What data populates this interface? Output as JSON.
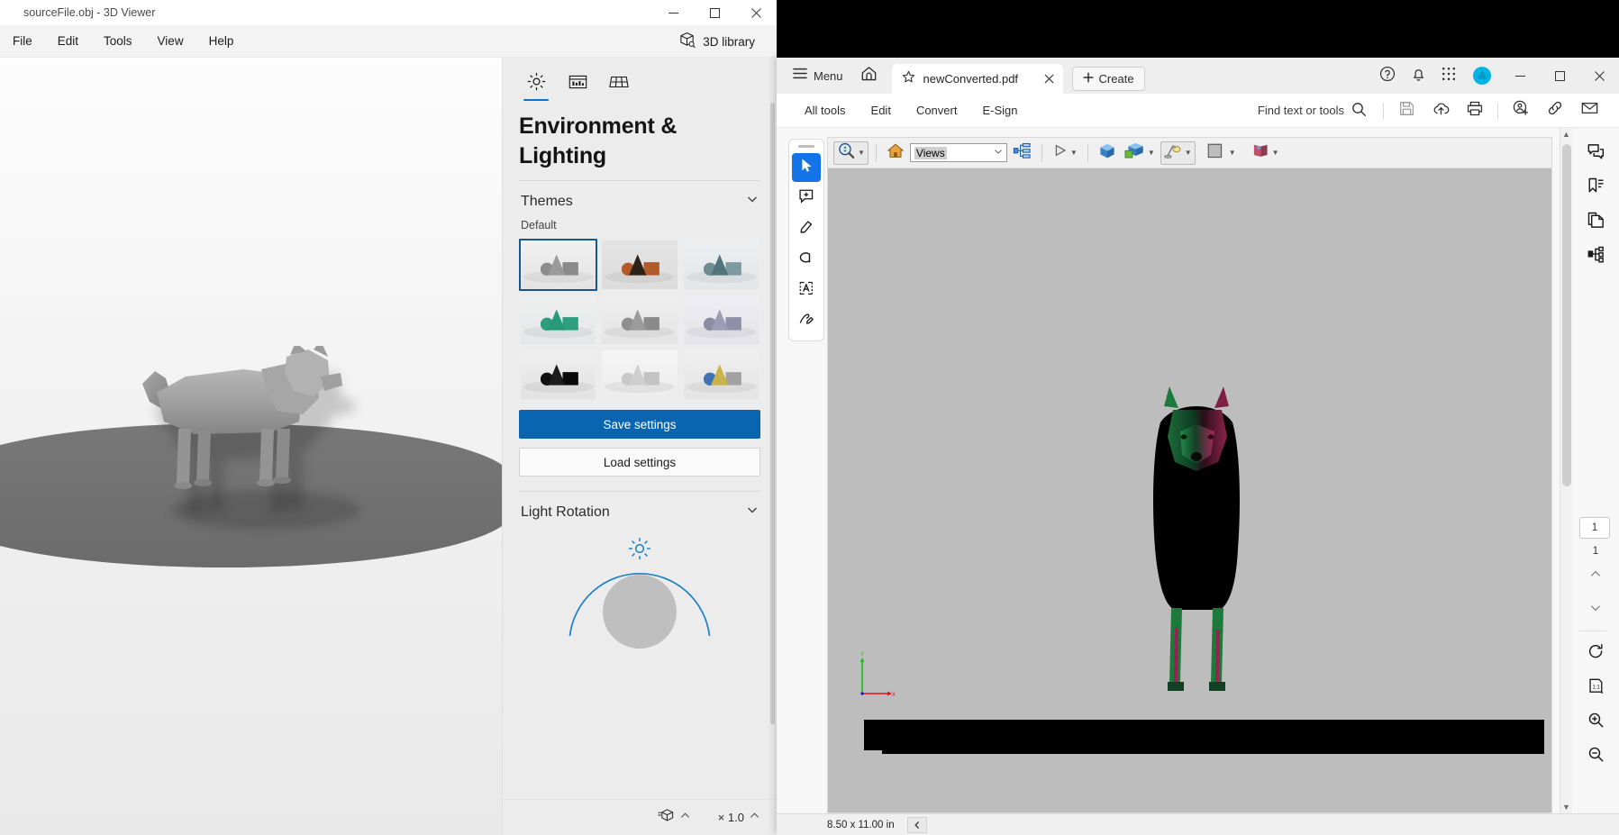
{
  "viewer": {
    "title": "sourceFile.obj - 3D Viewer",
    "window_controls": {
      "minimize": "minimize-icon",
      "maximize": "maximize-icon",
      "close": "close-icon"
    },
    "menu": [
      "File",
      "Edit",
      "Tools",
      "View",
      "Help"
    ],
    "library_button": "3D library",
    "panel": {
      "tabs": [
        {
          "name": "environment-lighting",
          "icon": "sun-icon",
          "active": true
        },
        {
          "name": "model-view",
          "icon": "filmstrip-icon",
          "active": false
        },
        {
          "name": "grid-stage",
          "icon": "grid-icon",
          "active": false
        }
      ],
      "heading": "Environment & Lighting",
      "themes_section": {
        "title": "Themes",
        "collapse_icon": "chevron-down-icon",
        "group_label": "Default",
        "items": [
          {
            "name": "theme-default-grey",
            "selected": true,
            "bg_top": "#f0f0f0",
            "bg_bottom": "#e3e3e3",
            "shape": "#8c8c8c",
            "cone": "#9a9a9a",
            "cube": "#8a8a8a"
          },
          {
            "name": "theme-sunset-orange",
            "selected": false,
            "bg_top": "#e4e4e4",
            "bg_bottom": "#dcdcdc",
            "shape": "#b35a2a",
            "cone": "#2c2218",
            "cube": "#b35a2a"
          },
          {
            "name": "theme-teal-light",
            "selected": false,
            "bg_top": "#eceff1",
            "bg_bottom": "#e3e6e8",
            "shape": "#6e8c91",
            "cone": "#52757c",
            "cube": "#7d9aa0"
          },
          {
            "name": "theme-emerald",
            "selected": false,
            "bg_top": "#eef0f0",
            "bg_bottom": "#e4e7e7",
            "shape": "#2e9e7e",
            "cone": "#26997a",
            "cube": "#2e9e7e"
          },
          {
            "name": "theme-neutral-grey",
            "selected": false,
            "bg_top": "#eeeeee",
            "bg_bottom": "#e4e4e4",
            "shape": "#8f8f8f",
            "cone": "#9b9b9b",
            "cube": "#8a8a8a"
          },
          {
            "name": "theme-lavender",
            "selected": false,
            "bg_top": "#ededf2",
            "bg_bottom": "#e4e4ea",
            "shape": "#8c8ca3",
            "cone": "#9c9cb5",
            "cube": "#8f8fa8"
          },
          {
            "name": "theme-dark-black",
            "selected": false,
            "bg_top": "#efefef",
            "bg_bottom": "#e2e2e2",
            "shape": "#111111",
            "cone": "#1c1c1c",
            "cube": "#0a0a0a"
          },
          {
            "name": "theme-bright-white",
            "selected": false,
            "bg_top": "#f5f5f5",
            "bg_bottom": "#ececec",
            "shape": "#c9c9c9",
            "cone": "#cfcfcf",
            "cube": "#c4c4c4"
          },
          {
            "name": "theme-multicolor",
            "selected": false,
            "bg_top": "#efefef",
            "bg_bottom": "#e4e4e4",
            "shape": "#3e73b5",
            "cone": "#c8b24a",
            "cube": "#a2a2a2"
          }
        ]
      },
      "save_button": "Save settings",
      "load_button": "Load settings",
      "light_rotation_section": {
        "title": "Light Rotation",
        "collapse_icon": "chevron-down-icon",
        "sun_icon": "sun-icon"
      }
    },
    "footer": {
      "model_icon": "model-stack-icon",
      "model_caret": "chevron-up-icon",
      "scale_label": "× 1.0",
      "scale_caret": "chevron-up-icon"
    }
  },
  "acrobat": {
    "tabbar": {
      "menu_icon": "hamburger-icon",
      "menu_label": "Menu",
      "home_icon": "home-icon",
      "tab": {
        "star_icon": "star-icon",
        "name": "newConverted.pdf",
        "close_icon": "close-icon"
      },
      "create_label": "Create",
      "create_icon": "plus-icon",
      "right_icons": [
        "help-circle-icon",
        "bell-icon",
        "apps-grid-icon"
      ],
      "avatar": "user-avatar",
      "avatar_color": "#00b5e2",
      "window_controls": {
        "minimize": "minimize-icon",
        "maximize": "maximize-icon",
        "close": "close-icon"
      }
    },
    "toolsbar": {
      "items": [
        "All tools",
        "Edit",
        "Convert",
        "E-Sign"
      ],
      "find_label": "Find text or tools",
      "find_icon": "search-icon",
      "actions": [
        "save-icon",
        "cloud-upload-icon",
        "print-icon",
        "add-comment-user-icon",
        "link-icon",
        "email-icon"
      ]
    },
    "left_tools": [
      {
        "name": "select-tool",
        "icon": "cursor-arrow-icon",
        "active": true
      },
      {
        "name": "add-comment-tool",
        "icon": "comment-plus-icon",
        "active": false
      },
      {
        "name": "highlight-tool",
        "icon": "highlighter-icon",
        "active": false
      },
      {
        "name": "draw-free-tool",
        "icon": "lasso-icon",
        "active": false
      },
      {
        "name": "add-text-tool",
        "icon": "text-box-icon",
        "active": false
      },
      {
        "name": "sign-tool",
        "icon": "sign-pen-icon",
        "active": false
      }
    ],
    "toolbar3d": {
      "rotate_tool": {
        "name": "rotate-3d-tool",
        "icon": "magnify-rotate-icon",
        "framed": true
      },
      "home_view": {
        "name": "default-view-button",
        "icon": "home-orange-icon"
      },
      "views_select": {
        "label": "Views",
        "caret": "chevron-down-icon"
      },
      "model_tree": {
        "name": "model-tree-button",
        "icon": "model-tree-icon"
      },
      "play": {
        "name": "play-animation-button",
        "icon": "play-triangle-icon"
      },
      "view_cube": {
        "name": "use-orthographic-button",
        "icon": "blue-cube-icon"
      },
      "cross_section": {
        "name": "cross-section-button",
        "icon": "two-cubes-icon"
      },
      "lighting": {
        "name": "model-lighting-button",
        "icon": "desk-lamp-icon",
        "framed": true
      },
      "background": {
        "name": "background-color-button",
        "icon": "color-swatch-icon"
      },
      "render_mode": {
        "name": "render-mode-button",
        "icon": "render-book-icon"
      }
    },
    "page": {
      "scene_bg": "#bdbdbd",
      "axis_labels": {
        "y": "Y",
        "x": "X"
      }
    },
    "right_tools_top": [
      "comment-panel-icon",
      "bookmark-panel-icon",
      "pages-panel-icon",
      "layers-panel-icon"
    ],
    "right_tools_bottom": {
      "current_page": "1",
      "total_pages": "1",
      "prev_icon": "chevron-up-icon",
      "next_icon": "chevron-down-icon",
      "rotate_icon": "rotate-cw-icon",
      "fit_icon": "actual-size-icon",
      "zoom_in_icon": "zoom-in-icon",
      "zoom_out_icon": "zoom-out-icon"
    },
    "status": {
      "page_size": "8.50 x 11.00 in",
      "collapse_icon": "chevron-left-icon"
    }
  }
}
